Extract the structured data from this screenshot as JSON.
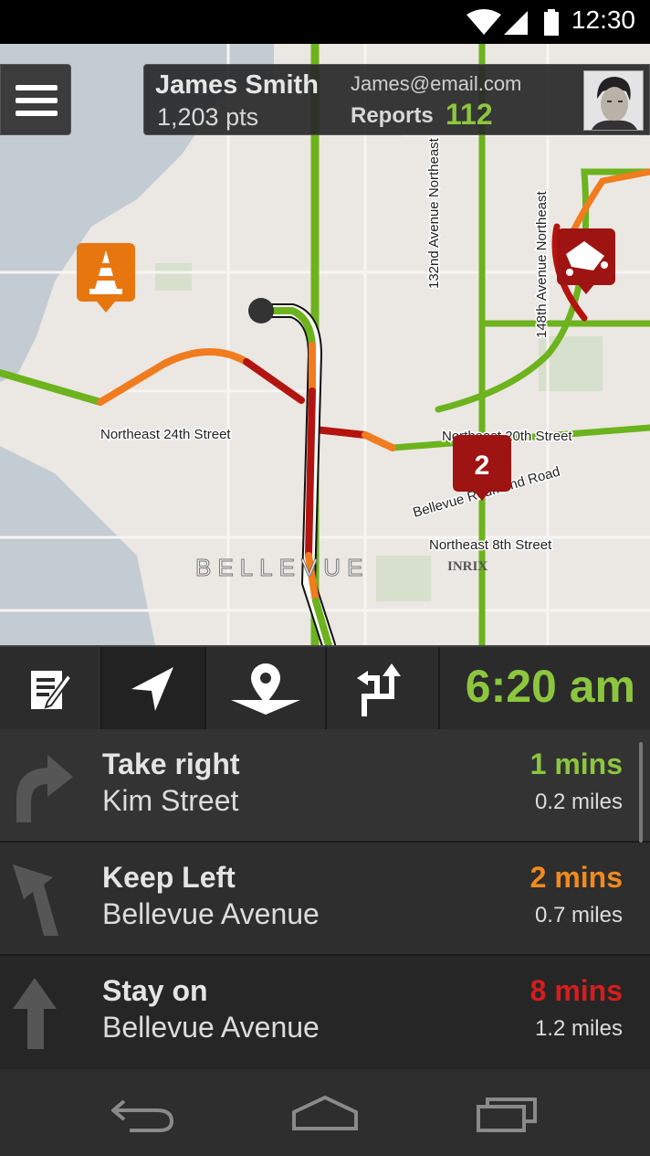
{
  "status_bar": {
    "time": "12:30"
  },
  "profile": {
    "name": "James Smith",
    "points": "1,203 pts",
    "email": "James@email.com",
    "reports_label": "Reports",
    "reports_count": "112"
  },
  "map": {
    "streets": {
      "ne24": "Northeast 24th Street",
      "ave132": "132nd Avenue Northeast",
      "ave148": "148th Avenue Northeast",
      "bellevue_redmond": "Bellevue Redmond Road",
      "ne8": "Northeast 8th Street",
      "ne_partial": "Northeast 20th Street"
    },
    "city_label": "BELLEVUE",
    "provider": "INRIX",
    "cluster_count": "2",
    "colors": {
      "green": "#6cb31e",
      "orange": "#f07c1f",
      "red": "#b3140f"
    }
  },
  "toolbar": {
    "eta": "6:20 am"
  },
  "directions": [
    {
      "action": "Take right",
      "street": "Kim Street",
      "mins": "1 mins",
      "miles": "0.2 miles",
      "color": "#8cc63f"
    },
    {
      "action": "Keep Left",
      "street": "Bellevue Avenue",
      "mins": "2 mins",
      "miles": "0.7 miles",
      "color": "#f28a1e"
    },
    {
      "action": "Stay on",
      "street": "Bellevue Avenue",
      "mins": "8 mins",
      "miles": "1.2 miles",
      "color": "#d61d1d"
    }
  ]
}
